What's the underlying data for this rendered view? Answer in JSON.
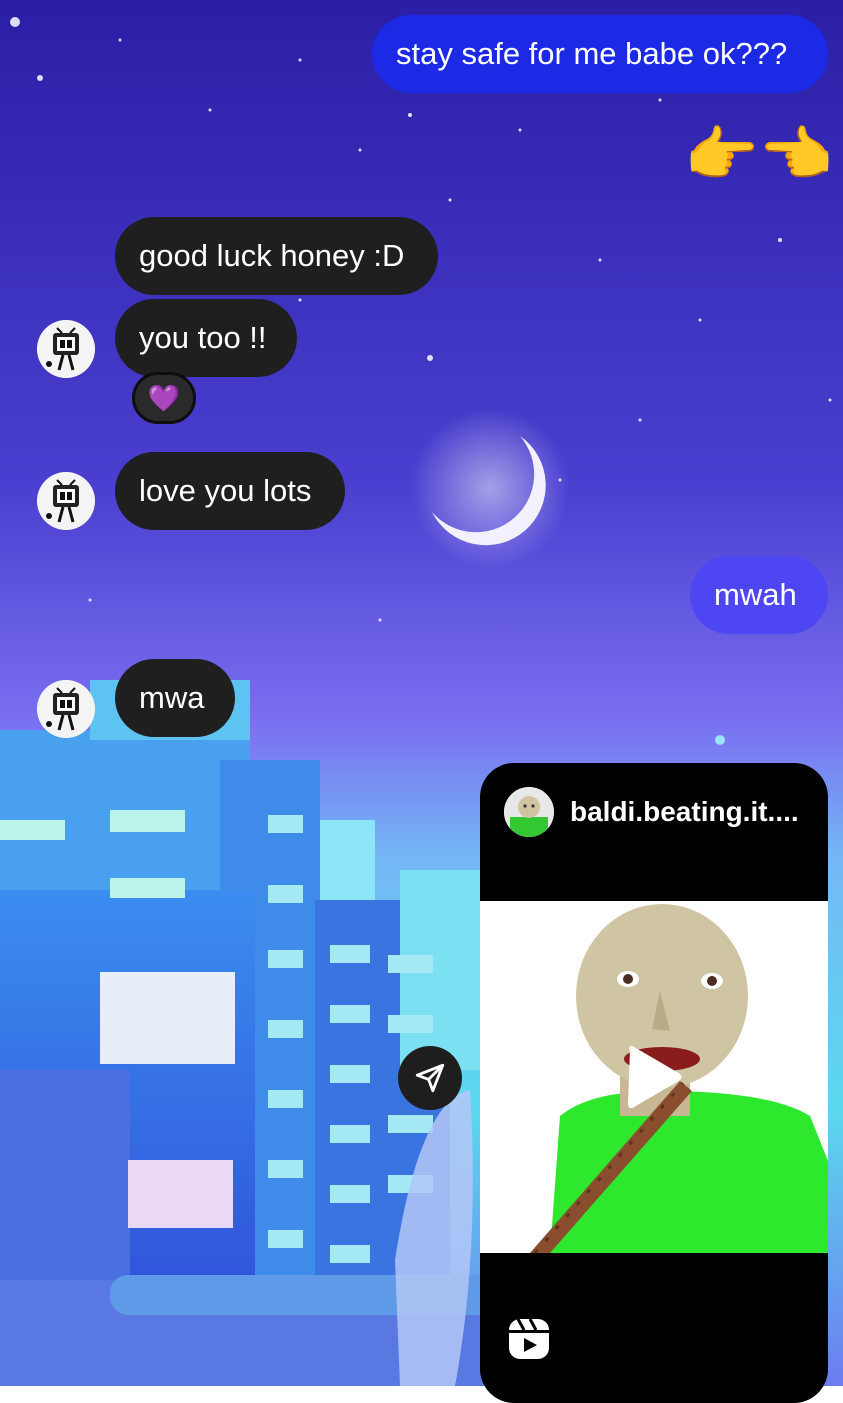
{
  "messages": [
    {
      "direction": "outgoing",
      "text": "stay safe for me babe ok???"
    },
    {
      "direction": "outgoing",
      "emoji": "👉👈"
    },
    {
      "direction": "incoming",
      "text": "good luck honey :D"
    },
    {
      "direction": "incoming",
      "text": "you too !!",
      "reaction": "💜"
    },
    {
      "direction": "incoming",
      "text": "love you lots"
    },
    {
      "direction": "outgoing",
      "text": "mwah"
    },
    {
      "direction": "incoming",
      "text": "mwa"
    }
  ],
  "shared_reel": {
    "username": "baldi.beating.it....",
    "icons": [
      "play-icon",
      "reels-icon",
      "share-icon"
    ]
  },
  "colors": {
    "incoming_bubble": "#1f1f1f",
    "outgoing_bubble_1": "#1c2ae6",
    "outgoing_bubble_2": "#4d46f2",
    "background_top": "#2f1fa8",
    "background_mid": "#6a5ce6"
  }
}
